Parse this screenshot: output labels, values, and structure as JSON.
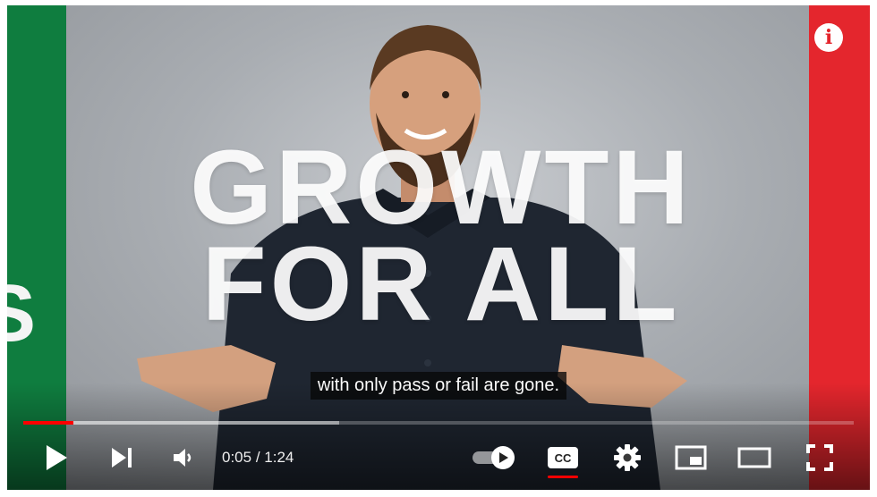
{
  "video": {
    "headline_line1": "GROWTH",
    "headline_line2": "FOR ALL",
    "side_letter": "S",
    "caption": "with only pass or fail are gone."
  },
  "player": {
    "current_time": "0:05",
    "separator": " / ",
    "duration": "1:24",
    "played_fraction": 0.06,
    "loaded_fraction": 0.38,
    "info_label": "i",
    "captions_enabled": true,
    "autoplay_enabled": true
  },
  "colors": {
    "left_stripe": "#0f7d3f",
    "right_stripe": "#e4262d",
    "progress_played": "#ff0000"
  },
  "icons": [
    "play-icon",
    "next-icon",
    "volume-icon",
    "autoplay-toggle-icon",
    "cc-icon",
    "settings-icon",
    "miniplayer-icon",
    "theater-icon",
    "fullscreen-icon",
    "info-icon"
  ]
}
